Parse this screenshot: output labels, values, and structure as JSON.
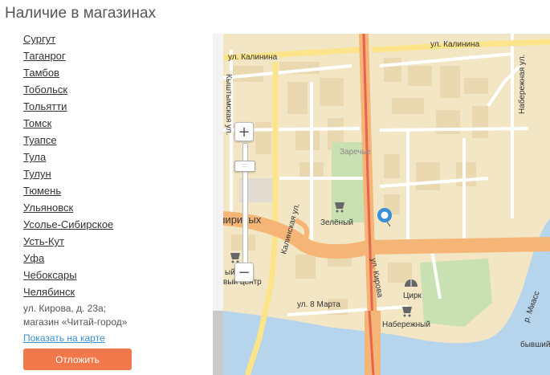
{
  "page": {
    "title": "Наличие в магазинах"
  },
  "cities": [
    "Сургут",
    "Таганрог",
    "Тамбов",
    "Тобольск",
    "Тольятти",
    "Томск",
    "Туапсе",
    "Тула",
    "Тулун",
    "Тюмень",
    "Ульяновск",
    "Усолье-Сибирское",
    "Усть-Кут",
    "Уфа",
    "Чебоксары",
    "Челябинск"
  ],
  "store": {
    "address_line1": "ул. Кирова, д. 23а;",
    "address_line2": "магазин «Читай-город»",
    "show_on_map": "Показать на карте",
    "defer_button": "Отложить"
  },
  "map": {
    "zoom_in": "+",
    "zoom_out": "−",
    "handle": "::::",
    "labels": {
      "kalinina_left": "ул. Калинина",
      "kalinina_right": "ул. Калинина",
      "kyshtymskaya": "Кыштымская ул.",
      "zarechye": "Заречье",
      "naberezhnaya": "Набережная ул.",
      "zeleny": "Зелёный",
      "shirinykh": "шириных",
      "kalininskaya": "Калинская ул.",
      "kirova": "ул. Кирова",
      "vosmogo_marta": "ул. 8 Марта",
      "tsirk": "Цирк",
      "naberezhny": "Набережный",
      "miass": "р. Миасс",
      "byvshiy": "бывший С",
      "tc_fragment_1": "ый",
      "tc_fragment_2": "вый центр"
    },
    "colors": {
      "land": "#f3e6c5",
      "water": "#b6d4eb",
      "park": "#c9e0b2",
      "major_road": "#f5b577",
      "main_axis": "#e8644e",
      "road": "#ffffff",
      "marker": "#3a8fd9"
    }
  }
}
